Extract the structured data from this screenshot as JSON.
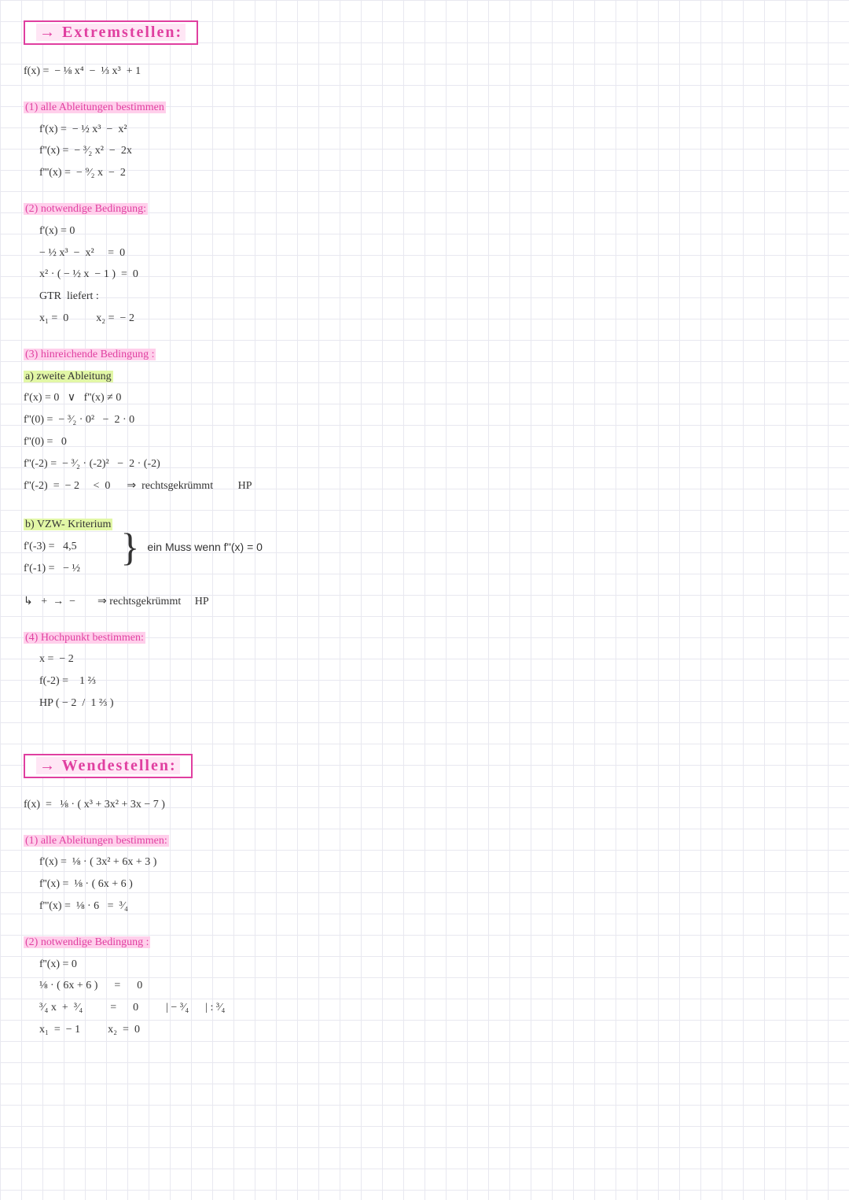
{
  "s1": {
    "title": "→ Extremstellen:",
    "func": "f(x) =  − ⅛ x⁴  −  ⅓ x³  + 1",
    "step1_title": "(1) alle Ableitungen bestimmen",
    "d1": "f'(x) =  − ½ x³  −  x²",
    "d2": "f''(x) =  − ³⁄₂ x²  −  2x",
    "d3": "f'''(x) =  − ⁹⁄₂ x  −  2",
    "step2_title": "(2) notwendige Bedingung:",
    "nb1": "f'(x) = 0",
    "nb2": "− ½ x³  −  x²     =  0",
    "nb3": "x² · ( − ½ x  − 1 )  =  0",
    "nb4": "GTR  liefert :",
    "nb5": "x₁ =  0          x₂ =  − 2",
    "step3_title": "(3) hinreichende Bedingung :",
    "s3a_title": "a) zweite Ableitung",
    "hb1": "f'(x) = 0   ∨   f''(x) ≠ 0",
    "hb2": "f''(0) =  − ³⁄₂ · 0²   −  2 · 0",
    "hb3": "f''(0) =   0",
    "hb4": "f''(-2) =  − ³⁄₂ · (-2)²   −  2 · (-2)",
    "hb5": "f''(-2)  =  − 2     <  0      ⇒  rechtsgekrümmt         HP",
    "s3b_title": "b) VZW- Kriterium",
    "vz1": "f'(-3) =   4,5",
    "vz2": "f'(-1) =   − ½",
    "vz_note": "ein  Muss    wenn  f''(x) = 0",
    "vz3": "↳   +  →  −        ⇒ rechtsgekrümmt     HP",
    "step4_title": "(4) Hochpunkt bestimmen:",
    "hp1": "x =  − 2",
    "hp2": "f(-2) =    1 ⅔",
    "hp3": "HP ( − 2  /  1 ⅔ )"
  },
  "s2": {
    "title": "→ Wendestellen:",
    "func": "f(x)  =   ⅛ · ( x³ + 3x² + 3x − 7 )",
    "step1_title": "(1) alle Ableitungen bestimmen:",
    "d1": "f'(x) =  ⅛ · ( 3x² + 6x + 3 )",
    "d2": "f''(x) =  ⅛ · ( 6x + 6 )",
    "d3": "f'''(x) =  ⅛ · 6   =  ³⁄₄",
    "step2_title": "(2) notwendige Bedingung :",
    "nb1": "f''(x) = 0",
    "nb2": "⅛ · ( 6x + 6 )      =      0",
    "nb3": "³⁄₄ x  +  ³⁄₄          =      0          | − ³⁄₄      | : ³⁄₄",
    "nb4": "x₁  =  − 1          x₂  =  0"
  }
}
